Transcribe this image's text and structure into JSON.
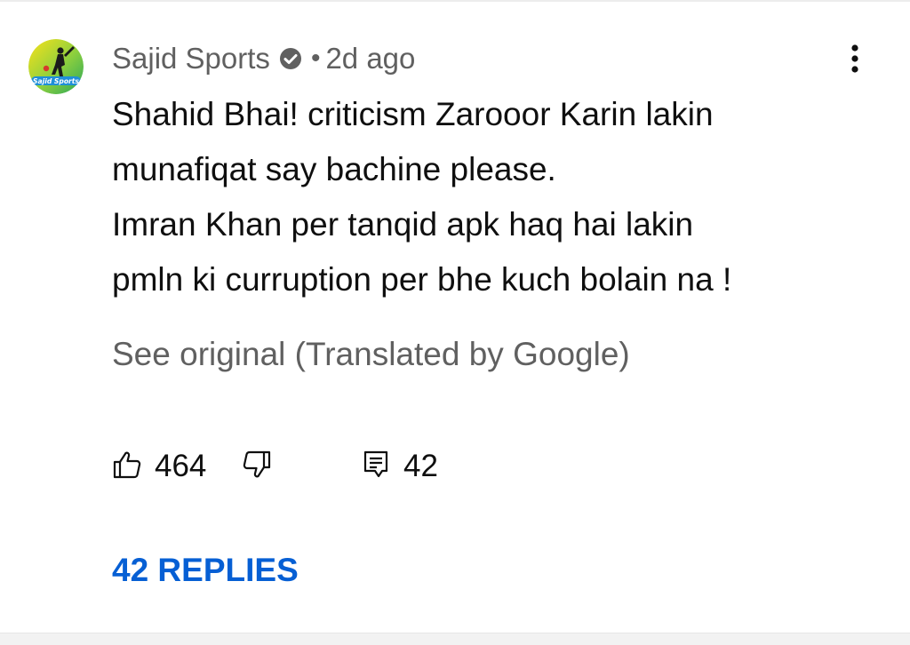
{
  "comment": {
    "author": "Sajid Sports",
    "avatar_icon": "sajid-sports-cricket-logo",
    "avatar_text": "Sajid Sports",
    "verified_icon": "verified-check-icon",
    "separator": "•",
    "timestamp": "2d ago",
    "menu_icon": "more-vert-icon",
    "lines": [
      "Shahid Bhai! criticism Zarooor Karin lakin",
      "munafiqat say bachine please.",
      "Imran Khan per tanqid apk haq hai lakin",
      "pmln ki curruption per bhe kuch bolain na !"
    ],
    "see_original": "See original (Translated by Google)"
  },
  "actions": {
    "like_icon": "thumbs-up-icon",
    "like_count": "464",
    "dislike_icon": "thumbs-down-icon",
    "reply_icon": "comment-icon",
    "reply_count": "42"
  },
  "replies_link": "42 REPLIES",
  "colors": {
    "text_primary": "#0f0f0f",
    "text_secondary": "#606060",
    "link_blue": "#065fd4",
    "avatar_green": "#3cb371",
    "avatar_yellow": "#f5d90a"
  }
}
